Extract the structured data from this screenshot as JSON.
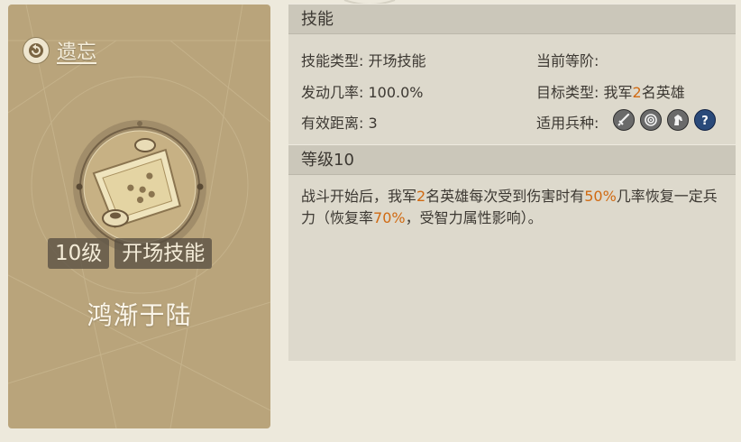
{
  "left": {
    "forget_label": "遗忘",
    "level_tag": "10级",
    "type_tag": "开场技能",
    "skill_name": "鸿渐于陆"
  },
  "skill_section": {
    "title": "技能",
    "type_label": "技能类型:",
    "type_value": "开场技能",
    "rank_label": "当前等阶:",
    "rank_value": "",
    "rate_label": "发动几率:",
    "rate_value": "100.0%",
    "target_label": "目标类型:",
    "target_prefix": "我军",
    "target_number": "2",
    "target_suffix": "名英雄",
    "range_label": "有效距离:",
    "range_value": "3",
    "troop_label": "适用兵种:",
    "troop_icons": [
      "sword-troop-icon",
      "archer-target-icon",
      "cavalry-horse-icon",
      "question-mark-icon"
    ]
  },
  "level_section": {
    "title": "等级10",
    "desc_1": "战斗开始后，我军",
    "desc_num1": "2",
    "desc_2": "名英雄每次受到伤害时有",
    "desc_pct1": "50%",
    "desc_3": "几率恢复一定兵力（恢复率",
    "desc_pct2": "70%",
    "desc_4": "，受智力属性影响）。"
  },
  "colors": {
    "highlight": "#d06a12",
    "left_panel": "#b9a47b",
    "right_panel": "#ddd9cc",
    "header": "#cbc7ba"
  }
}
